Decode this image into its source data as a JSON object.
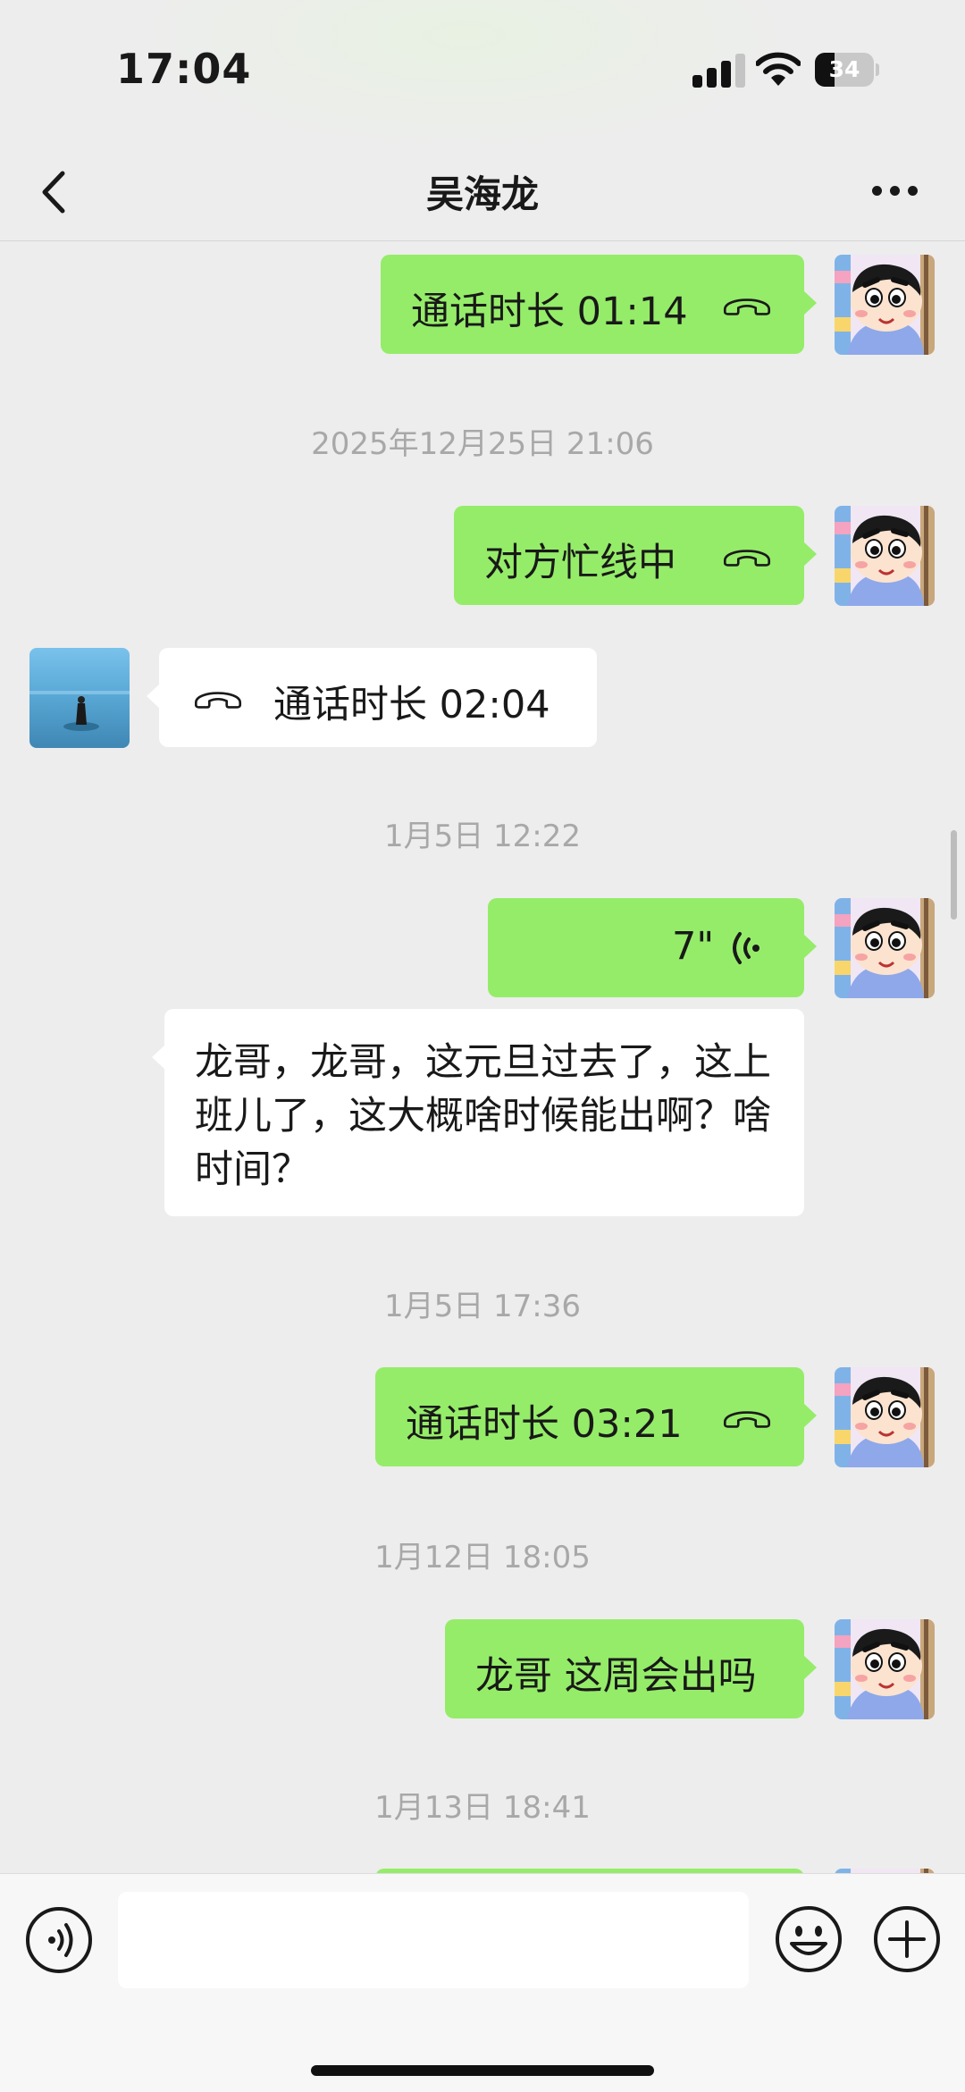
{
  "status_bar": {
    "time": "17:04",
    "battery": "34",
    "battery_level": 0.34,
    "icons": [
      "signal-icon",
      "wifi-icon",
      "battery-icon"
    ]
  },
  "nav": {
    "title": "吴海龙",
    "icons": [
      "back-arrow-icon",
      "more-icon"
    ]
  },
  "messages": [
    {
      "type": "call",
      "direction": "sent",
      "text": "通话时长 01:14"
    },
    {
      "type": "timestamp",
      "text": "2025年12月25日 21:06"
    },
    {
      "type": "call",
      "direction": "sent",
      "text": "对方忙线中"
    },
    {
      "type": "call",
      "direction": "received",
      "text": "通话时长 02:04"
    },
    {
      "type": "timestamp",
      "text": "1月5日 12:22"
    },
    {
      "type": "voice",
      "direction": "sent",
      "duration": "7\""
    },
    {
      "type": "voice-transcript",
      "text": "龙哥，龙哥，这元旦过去了，这上班儿了，这大概啥时候能出啊？啥时间？"
    },
    {
      "type": "timestamp",
      "text": "1月5日 17:36"
    },
    {
      "type": "call",
      "direction": "sent",
      "text": "通话时长 03:21"
    },
    {
      "type": "timestamp",
      "text": "1月12日 18:05"
    },
    {
      "type": "text",
      "direction": "sent",
      "text": "龙哥 这周会出吗"
    },
    {
      "type": "timestamp",
      "text": "1月13日 18:41"
    }
  ],
  "colors": {
    "sent_bubble": "#95ec69",
    "received_bubble": "#ffffff",
    "background": "#ededed",
    "timestamp_text": "#a8a8a8"
  },
  "input_bar": {
    "value": "",
    "icons": [
      "voice-input-icon",
      "emoji-icon",
      "plus-icon"
    ]
  }
}
